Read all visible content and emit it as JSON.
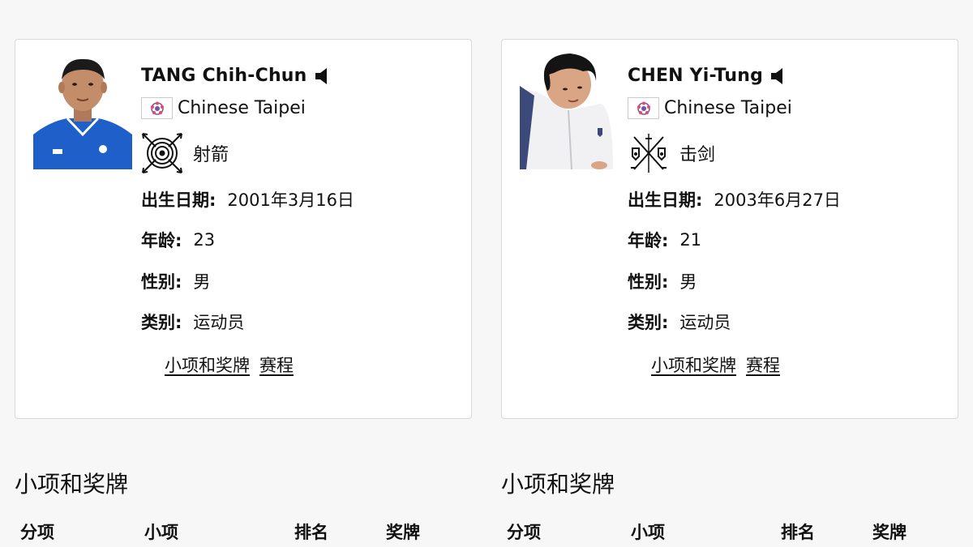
{
  "athletes": [
    {
      "name": "TANG Chih-Chun",
      "country": "Chinese Taipei",
      "sport": "射箭",
      "sport_icon": "archery-icon",
      "dob_label": "出生日期:",
      "dob": "2001年3月16日",
      "age_label": "年龄:",
      "age": "23",
      "gender_label": "性别:",
      "gender": "男",
      "category_label": "类别:",
      "category": "运动员",
      "link_events": "小项和奖牌",
      "link_schedule": "赛程"
    },
    {
      "name": "CHEN Yi-Tung",
      "country": "Chinese Taipei",
      "sport": "击剑",
      "sport_icon": "fencing-icon",
      "dob_label": "出生日期:",
      "dob": "2003年6月27日",
      "age_label": "年龄:",
      "age": "21",
      "gender_label": "性别:",
      "gender": "男",
      "category_label": "类别:",
      "category": "运动员",
      "link_events": "小项和奖牌",
      "link_schedule": "赛程"
    }
  ],
  "sections": [
    {
      "title": "小项和奖牌",
      "headers": [
        "分项",
        "小项",
        "排名",
        "奖牌"
      ]
    },
    {
      "title": "小项和奖牌",
      "headers": [
        "分项",
        "小项",
        "排名",
        "奖牌"
      ]
    }
  ],
  "colors": {
    "card_border": "#d9d9d9",
    "background": "#f7f7f7",
    "jersey_blue": "#1f5fc9",
    "flag_purple": "#7b4fa0"
  }
}
